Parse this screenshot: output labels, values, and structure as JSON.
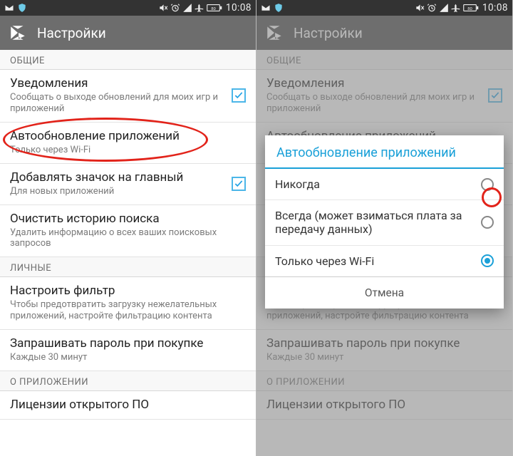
{
  "statusbar": {
    "time": "10:08"
  },
  "appbar": {
    "title": "Настройки"
  },
  "sections": {
    "general": "ОБЩИЕ",
    "personal": "ЛИЧНЫЕ",
    "about": "О ПРИЛОЖЕНИИ"
  },
  "rows": {
    "notif": {
      "title": "Уведомления",
      "sub": "Сообщать о выходе обновлений для моих игр и приложений",
      "checked": true
    },
    "autoupdate": {
      "title": "Автообновление приложений",
      "sub": "Только через Wi-Fi"
    },
    "addicon": {
      "title": "Добавлять значок на главный",
      "sub": "Для новых приложений",
      "checked": true
    },
    "clearsearch": {
      "title": "Очистить историю поиска",
      "sub": "Удалить информацию о всех ваших поисковых запросов"
    },
    "filter": {
      "title": "Настроить фильтр",
      "sub": "Чтобы предотвратить загрузку нежелательных приложений, настройте фильтрацию контента"
    },
    "password": {
      "title": "Запрашивать пароль при покупке",
      "sub": "Каждые 30 минут"
    },
    "licenses": {
      "title": "Лицензии открытого ПО",
      "sub": ""
    }
  },
  "dialog": {
    "title": "Автообновление приложений",
    "opts": {
      "never": "Никогда",
      "always": "Всегда (может взиматься плата за передачу данных)",
      "wifi": "Только через Wi-Fi"
    },
    "selected": "wifi",
    "cancel": "Отмена"
  },
  "icon_names": {
    "play_store": "play-store-icon",
    "mail": "mail-icon",
    "shield": "shield-icon",
    "mute": "mute-icon",
    "alarm": "alarm-icon",
    "signal": "signal-icon",
    "airplane": "airplane-icon",
    "battery": "battery-icon"
  }
}
